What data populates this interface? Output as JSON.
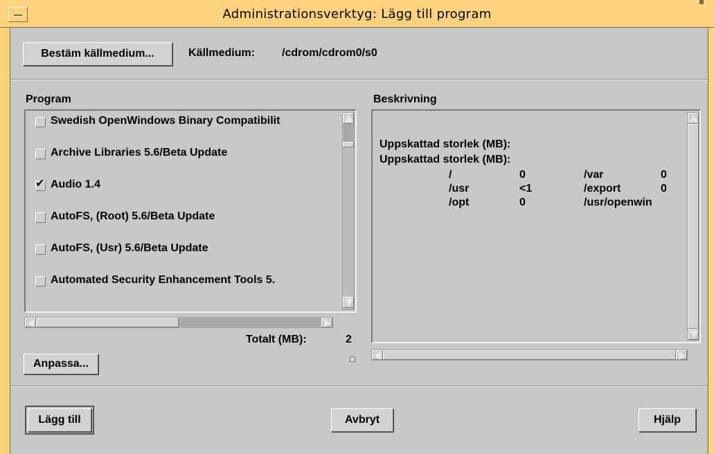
{
  "window": {
    "title": "Administrationsverktyg: Lägg till program"
  },
  "source": {
    "choose_button": "Bestäm källmedium...",
    "label": "Källmedium:",
    "value": "/cdrom/cdrom0/s0"
  },
  "program": {
    "heading": "Program",
    "items": [
      {
        "label": "Swedish OpenWindows Binary Compatibilit",
        "checked": false
      },
      {
        "label": "Archive Libraries 5.6/Beta Update",
        "checked": false
      },
      {
        "label": "Audio 1.4",
        "checked": true
      },
      {
        "label": "AutoFS, (Root) 5.6/Beta Update",
        "checked": false
      },
      {
        "label": "AutoFS, (Usr) 5.6/Beta Update",
        "checked": false
      },
      {
        "label": "Automated Security Enhancement Tools 5.",
        "checked": false
      }
    ],
    "check_glyph": "✔",
    "total_label": "Totalt (MB):",
    "total_value": "2",
    "customize_button": "Anpassa..."
  },
  "description": {
    "heading": "Beskrivning",
    "size_label_1": "Uppskattad storlek (MB):",
    "size_label_2": "Uppskattad storlek (MB):",
    "rows": [
      {
        "path1": "/",
        "size1": "0",
        "path2": "/var",
        "size2": "0"
      },
      {
        "path1": "/usr",
        "size1": "<1",
        "path2": "/export",
        "size2": "0"
      },
      {
        "path1": "/opt",
        "size1": "0",
        "path2": "/usr/openwin",
        "size2": ""
      }
    ]
  },
  "footer": {
    "add_button": "Lägg till",
    "cancel_button": "Avbryt",
    "help_button": "Hjälp"
  },
  "colors": {
    "titlebar": "#fdd27f",
    "background": "#c8c8c8"
  }
}
